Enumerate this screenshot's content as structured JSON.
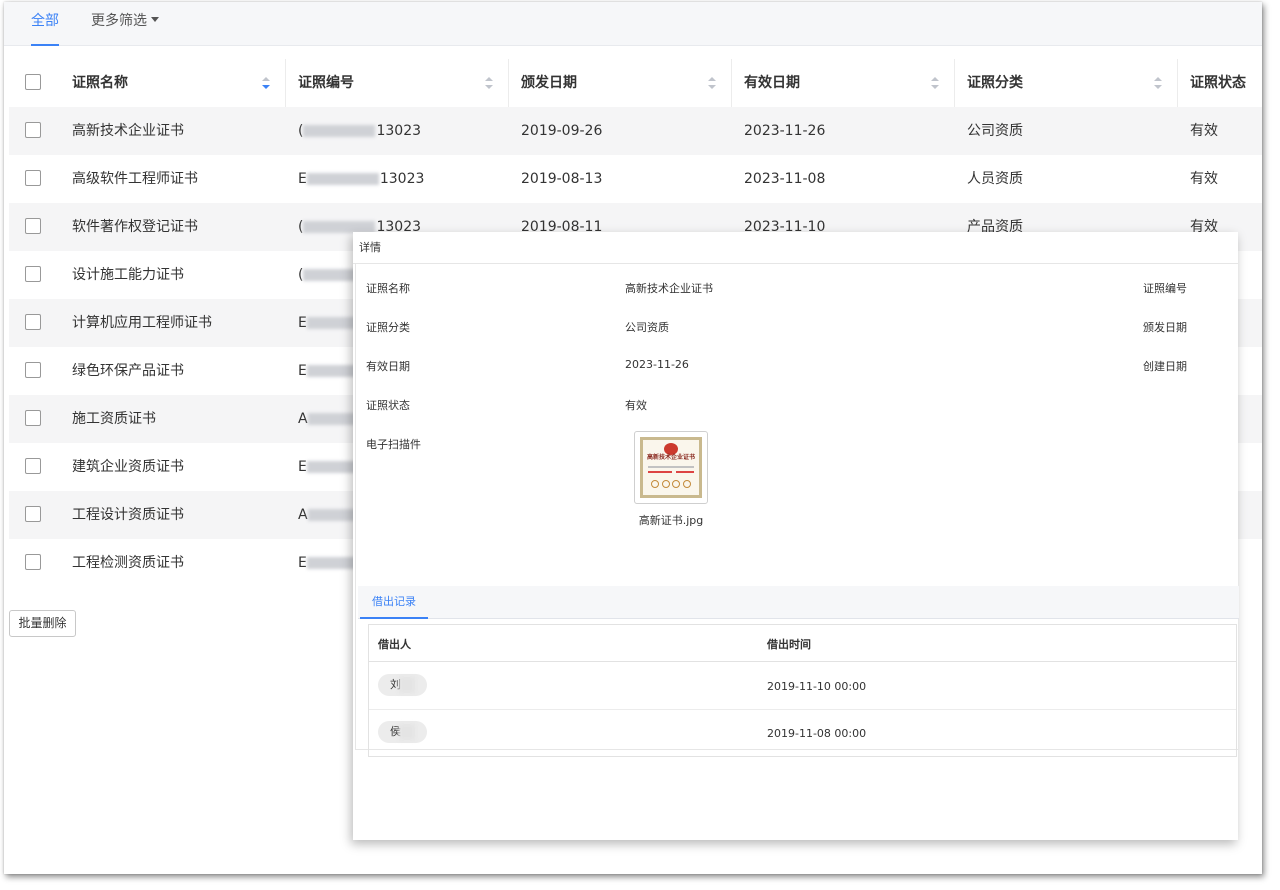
{
  "top_tabs": {
    "all": "全部",
    "more_filters": "更多筛选"
  },
  "table": {
    "columns": [
      "证照名称",
      "证照编号",
      "颁发日期",
      "有效日期",
      "证照分类",
      "证照状态"
    ],
    "rows": [
      {
        "name": "高新技术企业证书",
        "number_prefix": "(",
        "number_suffix": "13023",
        "issue_date": "2019-09-26",
        "valid_date": "2023-11-26",
        "category": "公司资质",
        "status": "有效"
      },
      {
        "name": "高级软件工程师证书",
        "number_prefix": "E",
        "number_suffix": "13023",
        "issue_date": "2019-08-13",
        "valid_date": "2023-11-08",
        "category": "人员资质",
        "status": "有效"
      },
      {
        "name": "软件著作权登记证书",
        "number_prefix": "(",
        "number_suffix": "13023",
        "issue_date": "2019-08-11",
        "valid_date": "2023-11-10",
        "category": "产品资质",
        "status": "有效"
      },
      {
        "name": "设计施工能力证书",
        "number_prefix": "(",
        "number_suffix": "",
        "issue_date": "",
        "valid_date": "",
        "category": "",
        "status": ""
      },
      {
        "name": "计算机应用工程师证书",
        "number_prefix": "E",
        "number_suffix": "",
        "issue_date": "",
        "valid_date": "",
        "category": "",
        "status": ""
      },
      {
        "name": "绿色环保产品证书",
        "number_prefix": "E",
        "number_suffix": "",
        "issue_date": "",
        "valid_date": "",
        "category": "",
        "status": ""
      },
      {
        "name": "施工资质证书",
        "number_prefix": "A",
        "number_suffix": "",
        "issue_date": "",
        "valid_date": "",
        "category": "",
        "status": ""
      },
      {
        "name": "建筑企业资质证书",
        "number_prefix": "E",
        "number_suffix": "",
        "issue_date": "",
        "valid_date": "",
        "category": "",
        "status": ""
      },
      {
        "name": "工程设计资质证书",
        "number_prefix": "A",
        "number_suffix": "",
        "issue_date": "",
        "valid_date": "",
        "category": "",
        "status": ""
      },
      {
        "name": "工程检测资质证书",
        "number_prefix": "E",
        "number_suffix": "",
        "issue_date": "",
        "valid_date": "",
        "category": "",
        "status": ""
      }
    ]
  },
  "batch_delete_label": "批量删除",
  "detail": {
    "title": "详情",
    "labels": {
      "name": "证照名称",
      "category": "证照分类",
      "valid_date": "有效日期",
      "status": "证照状态",
      "scan": "电子扫描件",
      "number": "证照编号",
      "issue_date": "颁发日期",
      "created_date": "创建日期"
    },
    "values": {
      "name": "高新技术企业证书",
      "category": "公司资质",
      "valid_date": "2023-11-26",
      "status": "有效"
    },
    "scan_file": {
      "filename": "高新证书.jpg",
      "cert_title": "高新技术企业证书"
    },
    "borrow_tab": "借出记录",
    "borrow_table": {
      "columns": [
        "借出人",
        "借出时间"
      ],
      "rows": [
        {
          "borrower": "刘",
          "time": "2019-11-10 00:00"
        },
        {
          "borrower": "侯",
          "time": "2019-11-08 00:00"
        }
      ]
    }
  },
  "colors": {
    "accent": "#3b82f6",
    "zebra": "#f5f5f6",
    "header_bg": "#f6f7f9"
  }
}
